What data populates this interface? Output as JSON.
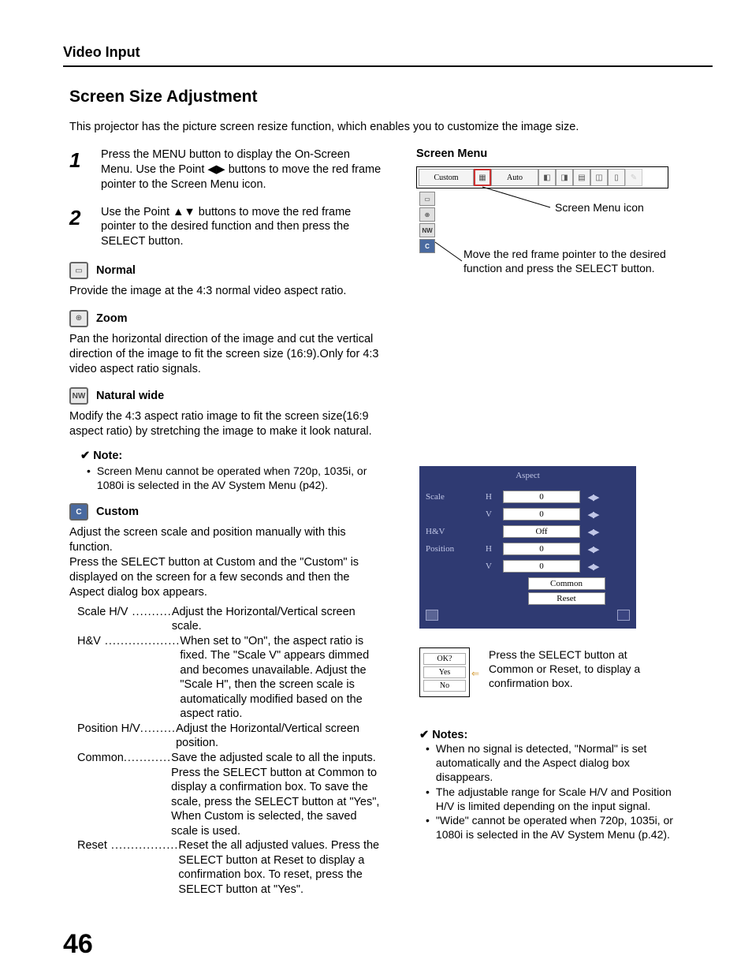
{
  "running_head": "Video Input",
  "section_title": "Screen Size Adjustment",
  "intro": "This projector has the picture screen resize function, which enables you to customize the image size.",
  "steps": {
    "1": "Press the MENU button to display the On-Screen Menu. Use the Point ◀▶ buttons to move the red frame pointer to the Screen Menu icon.",
    "2": "Use the Point ▲▼ buttons to move the red frame pointer to the desired function and then press the SELECT button."
  },
  "modes": {
    "normal": {
      "label": "Normal",
      "desc": "Provide the image at the 4:3 normal video aspect ratio."
    },
    "zoom": {
      "label": "Zoom",
      "desc": "Pan the horizontal direction of the image and cut the vertical direction of the image to fit the screen size (16:9).Only for 4:3 video aspect ratio signals."
    },
    "nw": {
      "label": "Natural wide",
      "desc": "Modify the 4:3 aspect ratio image to fit the screen size(16:9 aspect ratio) by stretching the image to make it look natural."
    },
    "custom": {
      "label": "Custom",
      "desc": "Adjust the screen scale and position manually with this function.\nPress the SELECT button at Custom and the \"Custom\" is displayed on the screen for a few seconds and then the Aspect dialog box appears."
    }
  },
  "note1": {
    "head": "Note:",
    "body": "Screen Menu cannot be operated when 720p, 1035i, or 1080i is selected in the AV System Menu (p42)."
  },
  "defs": {
    "scale_hv": {
      "term": "Scale H/V",
      "dots": " .......... ",
      "desc": "Adjust the Horizontal/Vertical screen scale."
    },
    "hv": {
      "term": "H&V",
      "dots": " ................... ",
      "desc": "When set to \"On\", the aspect ratio is fixed. The \"Scale V\" appears dimmed and becomes unavailable. Adjust the \"Scale H\", then the screen scale is automatically modified based on the aspect ratio."
    },
    "pos_hv": {
      "term": "Position H/V",
      "dots": ".........",
      "desc": "Adjust the Horizontal/Vertical screen position."
    },
    "common": {
      "term": "Common",
      "dots": "............ ",
      "desc": "Save the adjusted scale to all the inputs. Press the SELECT button at Common to display a confirmation box. To save the scale, press the SELECT button at \"Yes\", When Custom is selected, the saved scale is used."
    },
    "reset": {
      "term": "Reset",
      "dots": " ................. ",
      "desc": "Reset the all adjusted values. Press the SELECT button at Reset to display a confirmation box. To reset, press the SELECT button at \"Yes\"."
    }
  },
  "right": {
    "screen_menu_head": "Screen Menu",
    "tabs": {
      "custom": "Custom",
      "auto": "Auto"
    },
    "annot_icon": "Screen Menu icon",
    "annot_move": "Move the red frame pointer to the desired function and press the SELECT button.",
    "side_icons": {
      "nw": "NW",
      "c": "C"
    },
    "aspect": {
      "title": "Aspect",
      "scale": "Scale",
      "hv": "H&V",
      "position": "Position",
      "H": "H",
      "V": "V",
      "zero": "0",
      "off": "Off",
      "common": "Common",
      "reset": "Reset",
      "arrows": "◀▶"
    },
    "ok": {
      "q": "OK?",
      "yes": "Yes",
      "no": "No",
      "text": "Press the SELECT button at Common or Reset, to display a confirmation box."
    },
    "notes2": {
      "head": "Notes:",
      "b1": "When no signal is detected, \"Normal\" is set automatically and the Aspect dialog box disappears.",
      "b2": "The adjustable range for Scale H/V and Position H/V is limited depending on the input signal.",
      "b3": "\"Wide\" cannot be operated when 720p, 1035i, or 1080i is selected in the AV System Menu (p.42)."
    }
  },
  "page_number": "46"
}
